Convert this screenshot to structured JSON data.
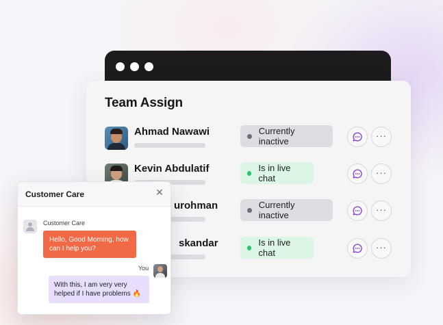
{
  "team_panel": {
    "title": "Team Assign",
    "members": [
      {
        "name": "Ahmad Nawawi",
        "status": "Currently inactive",
        "state": "inactive"
      },
      {
        "name": "Kevin Abdulatif",
        "status": "Is in live chat",
        "state": "live"
      },
      {
        "name": "urohman",
        "status": "Currently inactive",
        "state": "inactive"
      },
      {
        "name": "skandar",
        "status": "Is in live chat",
        "state": "live"
      }
    ],
    "more_glyph": "···"
  },
  "care_popup": {
    "title": "Customer Care",
    "close_glyph": "✕",
    "agent_label": "Customer Care",
    "agent_message": "Hello, Good Morning, how can I help you?",
    "you_label": "You",
    "you_message": "With this, I am very very helped if I have problems 🔥"
  },
  "colors": {
    "agent_bubble": "#f26a45",
    "user_bubble": "#e6defb",
    "live_status": "#dcf5e5",
    "inactive_status": "#dcdde1",
    "chat_icon": "#8b3fd6"
  }
}
